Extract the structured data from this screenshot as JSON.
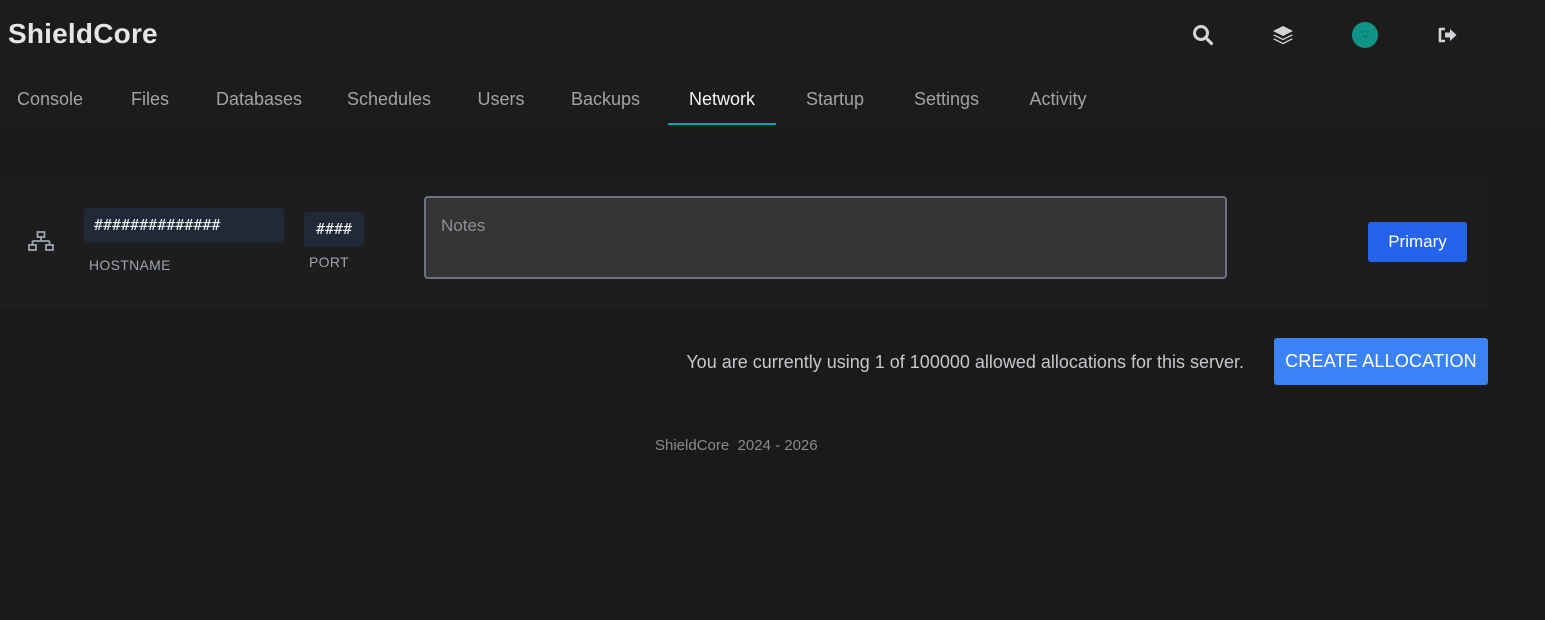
{
  "app": {
    "brand": "ShieldCore"
  },
  "header": {
    "icons": [
      "search-icon",
      "layers-icon",
      "avatar",
      "sign-out-icon"
    ],
    "avatar_color": "#0f9488"
  },
  "nav": {
    "tabs": [
      {
        "label": "Console"
      },
      {
        "label": "Files"
      },
      {
        "label": "Databases"
      },
      {
        "label": "Schedules"
      },
      {
        "label": "Users"
      },
      {
        "label": "Backups"
      },
      {
        "label": "Network"
      },
      {
        "label": "Startup"
      },
      {
        "label": "Settings"
      },
      {
        "label": "Activity"
      }
    ],
    "active_tab": "Network",
    "active_color": "#06a3b7"
  },
  "allocation": {
    "icon": "network-icon",
    "hostname": "##############",
    "hostname_label": "HOSTNAME",
    "port": "####",
    "port_label": "PORT",
    "notes_placeholder": "Notes",
    "primary_label": "Primary",
    "primary_color": "#2563eb"
  },
  "usage": {
    "text": "You are currently using 1 of 100000 allowed allocations for this server.",
    "create_label": "CREATE ALLOCATION",
    "create_color": "#3b82f6"
  },
  "footer": {
    "text": "ShieldCore  2024 - 2026"
  }
}
